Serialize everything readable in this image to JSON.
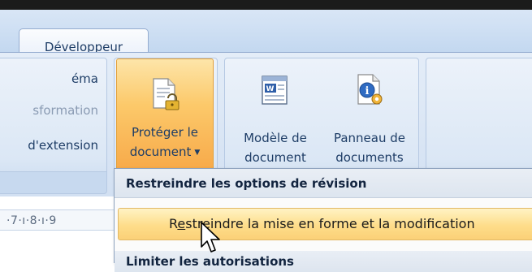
{
  "window": {
    "frame_color": "#1b1b1b"
  },
  "tabs": {
    "developer": "Développeur"
  },
  "ribbon": {
    "group1": {
      "row1": "éma",
      "row2": "sformation",
      "row3": "d'extension"
    },
    "protect": {
      "line1": "Protéger le",
      "line2": "document",
      "icon": "lock-document-icon"
    },
    "model": {
      "line1": "Modèle de",
      "line2": "document",
      "icon": "word-template-icon"
    },
    "panel": {
      "line1": "Panneau de",
      "line2": "documents",
      "icon": "document-info-gear-icon"
    }
  },
  "ruler": {
    "text": "·7·ı·8·ı·9"
  },
  "menu": {
    "header": "Restreindre les options de révision",
    "item_prefix": "R",
    "item_accel": "e",
    "item_rest": "streindre la mise en forme et la modification",
    "next_header": "Limiter les autorisations"
  },
  "colors": {
    "accent_orange": "#fcc96a",
    "ribbon_blue": "#d2e0f2",
    "highlight": "#fedd8a"
  }
}
